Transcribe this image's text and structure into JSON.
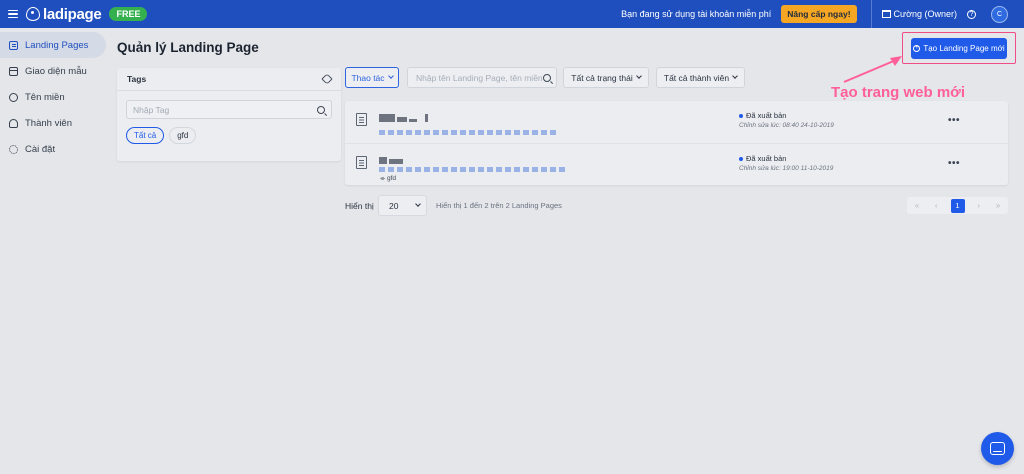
{
  "header": {
    "logo_text": "ladipage",
    "plan_badge": "FREE",
    "free_notice": "Bạn đang sử dụng tài khoản miễn phí",
    "upgrade_label": "Nâng cấp ngay!",
    "account_label": "Cường (Owner)",
    "help_label": "?",
    "avatar_initial": "C"
  },
  "sidebar": {
    "items": [
      {
        "label": "Landing Pages",
        "icon": "page-icon",
        "active": true
      },
      {
        "label": "Giao diện mẫu",
        "icon": "template-icon"
      },
      {
        "label": "Tên miền",
        "icon": "globe-icon"
      },
      {
        "label": "Thành viên",
        "icon": "user-icon"
      },
      {
        "label": "Cài đặt",
        "icon": "gear-icon"
      }
    ]
  },
  "main": {
    "title": "Quản lý Landing Page",
    "create_button": "Tạo Landing Page mới",
    "tags": {
      "heading": "Tags",
      "search_placeholder": "Nhập Tag",
      "pills": [
        "Tất cả",
        "gfd"
      ]
    },
    "toolbar": {
      "actions_label": "Thao tác",
      "search_placeholder": "Nhập tên Landing Page, tên miền",
      "status_filter": "Tất cả trạng thái",
      "member_filter": "Tất cả thành viên"
    },
    "rows": [
      {
        "status": "Đã xuất bản",
        "edited": "Chỉnh sửa lúc: 08:40 24-10-2019",
        "tag": ""
      },
      {
        "status": "Đã xuất bản",
        "edited": "Chỉnh sửa lúc: 19:00 11-10-2019",
        "tag": "gfd"
      }
    ],
    "pagination": {
      "show_label": "Hiển thị",
      "per_page": "20",
      "info": "Hiển thị 1 đến 2 trên 2 Landing Pages",
      "current_page": "1",
      "first": "«",
      "prev": "‹",
      "next": "›",
      "last": "»"
    }
  },
  "annotation": {
    "text": "Tạo trang web mới",
    "color": "#ff5f98"
  },
  "colors": {
    "header_bg": "#1f4fbf",
    "primary": "#1f5ae8",
    "free_badge": "#35b04f",
    "upgrade": "#f5a623"
  }
}
